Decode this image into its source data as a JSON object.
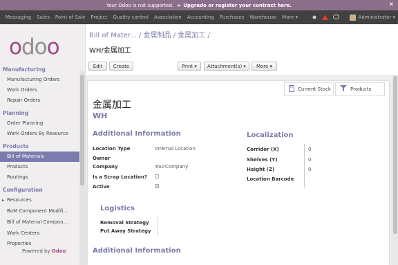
{
  "banner": {
    "text": "Your Odoo is not supported.",
    "link": "Upgrade or register your contract here.",
    "arrow": "➜",
    "close": "✕"
  },
  "nav": {
    "items": [
      "Messaging",
      "Sales",
      "Point of Sale",
      "Project",
      "Quality control",
      "Association",
      "Accounting",
      "Purchases",
      "Warehouse",
      "More ▾"
    ],
    "user": "Administrator ▾"
  },
  "logo": {
    "brand": "odoo"
  },
  "sidebar": {
    "sections": [
      {
        "title": "Manufacturing",
        "items": [
          "Manufacturing Orders",
          "Work Orders",
          "Repair Orders"
        ]
      },
      {
        "title": "Planning",
        "items": [
          "Order Planning",
          "Work Orders By Resource"
        ]
      },
      {
        "title": "Products",
        "items": [
          "Bill of Materials",
          "Products",
          "Routings"
        ]
      },
      {
        "title": "Configuration",
        "items": [
          "Resources",
          "BoM Component Modifi...",
          "Bill of Material Compon...",
          "Work Centers",
          "Properties"
        ]
      }
    ],
    "resources_arrow": "▸",
    "powered_label": "Powered by",
    "powered_brand": "Odoo"
  },
  "breadcrumb": {
    "crumbs": [
      "Bill of Mater...",
      "金属制品",
      "金属加工"
    ],
    "separator": "/"
  },
  "page_title": "WH/金属加工",
  "toolbar": {
    "edit": "Edit",
    "create": "Create",
    "print": "Print ▾",
    "attachments": "Attachment(s) ▾",
    "more": "More ▾"
  },
  "smart_buttons": {
    "current_stock": "Current Stock",
    "products": "Products"
  },
  "record": {
    "name": "金属加工",
    "subtitle": "WH"
  },
  "additional_info": {
    "title": "Additional Information",
    "fields": [
      {
        "label": "Location Type",
        "value": "Internal Location"
      },
      {
        "label": "Owner",
        "value": ""
      },
      {
        "label": "Company",
        "value": "YourCompany"
      },
      {
        "label": "Is a Scrap Location?",
        "value": ""
      },
      {
        "label": "Active",
        "value": "✓"
      }
    ]
  },
  "localization": {
    "title": "Localization",
    "fields": [
      {
        "label": "Corridor (X)",
        "value": "0"
      },
      {
        "label": "Shelves (Y)",
        "value": "0"
      },
      {
        "label": "Height (Z)",
        "value": "0"
      },
      {
        "label": "Location Barcode",
        "value": ""
      }
    ]
  },
  "logistics": {
    "title": "Logistics",
    "fields": [
      {
        "label": "Removal Strategy",
        "value": ""
      },
      {
        "label": "Put Away Strategy",
        "value": ""
      }
    ]
  },
  "additional_info_2": {
    "title": "Additional Information"
  }
}
